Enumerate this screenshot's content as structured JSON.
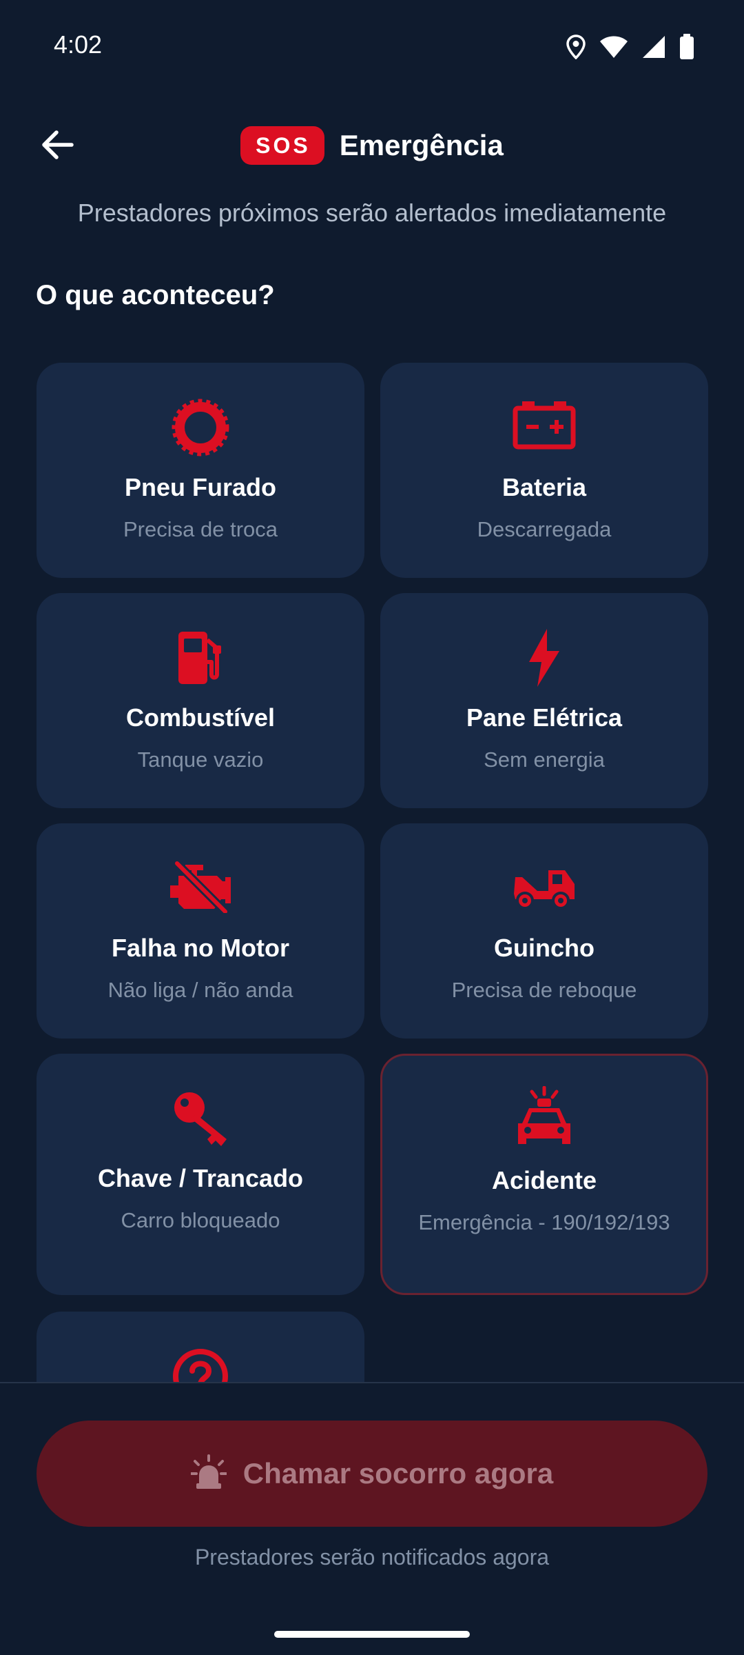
{
  "status_bar": {
    "time": "4:02",
    "icons": [
      "location-icon",
      "wifi-icon",
      "signal-icon",
      "battery-icon"
    ]
  },
  "header": {
    "back_icon": "arrow-left-icon",
    "badge": "SOS",
    "title": "Emergência",
    "subtitle": "Prestadores próximos serão alertados imediatamente"
  },
  "section": {
    "question": "O que aconteceu?"
  },
  "cards": [
    {
      "icon": "tire-icon",
      "title": "Pneu Furado",
      "subtitle": "Precisa de troca"
    },
    {
      "icon": "battery-car-icon",
      "title": "Bateria",
      "subtitle": "Descarregada"
    },
    {
      "icon": "fuel-pump-icon",
      "title": "Combustível",
      "subtitle": "Tanque vazio"
    },
    {
      "icon": "lightning-icon",
      "title": "Pane Elétrica",
      "subtitle": "Sem energia"
    },
    {
      "icon": "engine-off-icon",
      "title": "Falha no Motor",
      "subtitle": "Não liga / não anda"
    },
    {
      "icon": "tow-truck-icon",
      "title": "Guincho",
      "subtitle": "Precisa de reboque"
    },
    {
      "icon": "key-icon",
      "title": "Chave / Trancado",
      "subtitle": "Carro bloqueado"
    },
    {
      "icon": "police-car-icon",
      "title": "Acidente",
      "subtitle": "Emergência - 190/192/193",
      "selected": true
    },
    {
      "icon": "question-circle-icon",
      "title": "",
      "subtitle": ""
    }
  ],
  "footer": {
    "button_icon": "alarm-light-icon",
    "button_label": "Chamar socorro agora",
    "note": "Prestadores serão notificados agora"
  },
  "colors": {
    "background": "#0f1b2e",
    "card": "#182945",
    "accent": "#dc0f22",
    "button_disabled": "#5e1521",
    "muted_text": "#8291a6"
  }
}
